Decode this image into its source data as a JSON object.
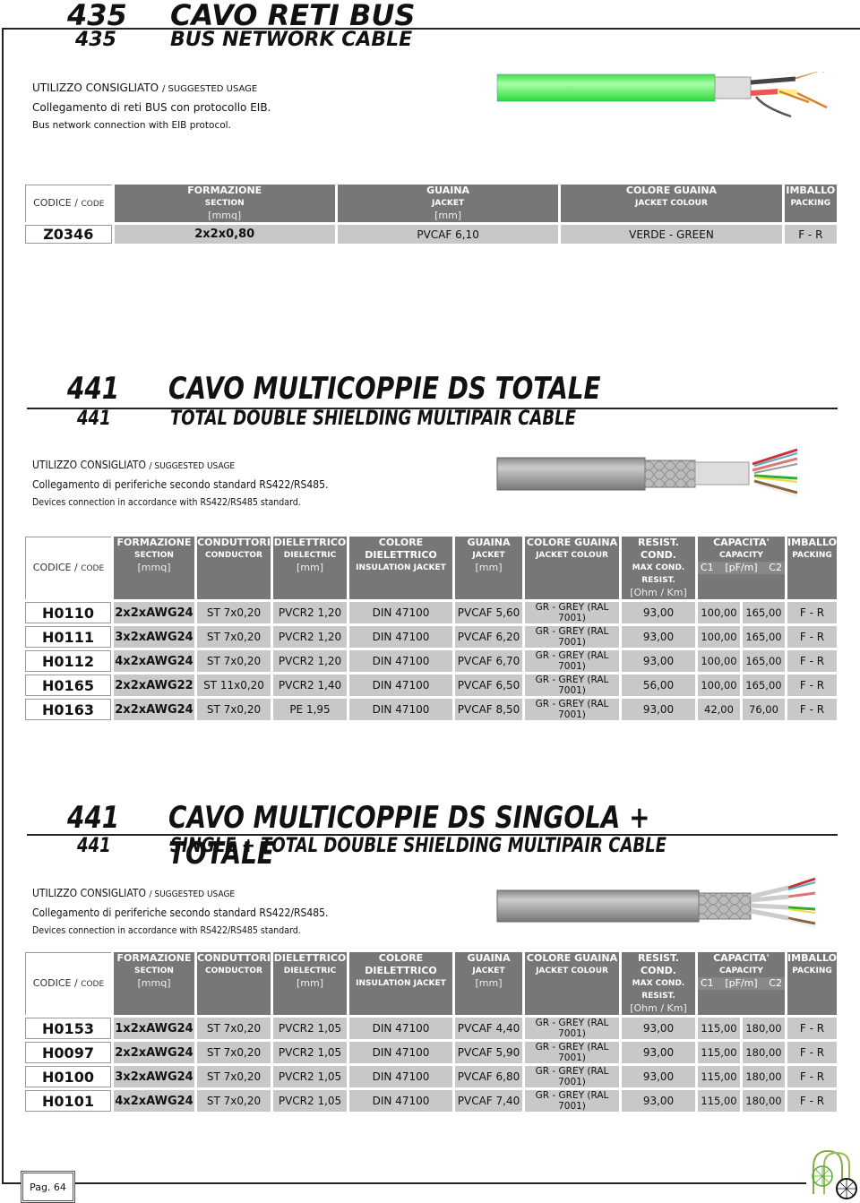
{
  "section_435": {
    "number": "435",
    "title_it": "CAVO RETI BUS",
    "title_en": "BUS NETWORK CABLE",
    "usage_label_it": "UTILIZZO CONSIGLIATO",
    "usage_label_en": "/ SUGGESTED USAGE",
    "usage_it": "Collegamento di reti BUS con protocollo EIB.",
    "usage_en": "Bus network connection with EIB protocol.",
    "table": {
      "code_header": "CODICE /",
      "code_header_small": "CODE",
      "headers": [
        {
          "it": "FORMAZIONE",
          "en": "SECTION",
          "unit": "[mmq]"
        },
        {
          "it": "GUAINA",
          "en": "JACKET",
          "unit": "[mm]"
        },
        {
          "it": "COLORE GUAINA",
          "en": "JACKET COLOUR",
          "unit": ""
        },
        {
          "it": "IMBALLO",
          "en": "PACKING",
          "unit": ""
        }
      ],
      "rows": [
        {
          "code": "Z0346",
          "section": "2x2x0,80",
          "jacket": "PVCAF 6,10",
          "colour": "VERDE - GREEN",
          "packing": "F - R"
        }
      ]
    }
  },
  "section_441a": {
    "number": "441",
    "title_it": "CAVO MULTICOPPIE DS TOTALE",
    "title_en": "TOTAL DOUBLE SHIELDING MULTIPAIR CABLE",
    "usage_label_it": "UTILIZZO CONSIGLIATO",
    "usage_label_en": "/ SUGGESTED USAGE",
    "usage_it": "Collegamento di periferiche secondo standard RS422/RS485.",
    "usage_en": "Devices connection in accordance with RS422/RS485 standard.",
    "table": {
      "code_header": "CODICE /",
      "code_header_small": "CODE",
      "headers": [
        {
          "it": "FORMAZIONE",
          "en": "SECTION",
          "unit": "[mmq]"
        },
        {
          "it": "CONDUTTORI",
          "en": "CONDUCTOR",
          "unit": ""
        },
        {
          "it": "DIELETTRICO",
          "en": "DIELECTRIC",
          "unit": "[mm]"
        },
        {
          "it": "COLORE DIELETTRICO",
          "en": "INSULATION JACKET",
          "unit": ""
        },
        {
          "it": "GUAINA",
          "en": "JACKET",
          "unit": "[mm]"
        },
        {
          "it": "COLORE GUAINA",
          "en": "JACKET COLOUR",
          "unit": ""
        },
        {
          "it": "RESIST. COND.",
          "en": "MAX COND. RESIST.",
          "unit": "[Ohm / Km]"
        },
        {
          "it": "CAPACITA'",
          "en": "CAPACITY",
          "unit": "[pF/m]",
          "c1": "C1",
          "c2": "C2"
        },
        {
          "it": "IMBALLO",
          "en": "PACKING",
          "unit": ""
        }
      ],
      "rows": [
        {
          "code": "H0110",
          "section": "2x2xAWG24",
          "conductor": "ST 7x0,20",
          "dielectric": "PVCR2 1,20",
          "insulation": "DIN 47100",
          "jacket": "PVCAF 5,60",
          "colour": "GR - GREY (RAL 7001)",
          "resist": "93,00",
          "c1": "100,00",
          "c2": "165,00",
          "packing": "F - R"
        },
        {
          "code": "H0111",
          "section": "3x2xAWG24",
          "conductor": "ST 7x0,20",
          "dielectric": "PVCR2 1,20",
          "insulation": "DIN 47100",
          "jacket": "PVCAF 6,20",
          "colour": "GR - GREY (RAL 7001)",
          "resist": "93,00",
          "c1": "100,00",
          "c2": "165,00",
          "packing": "F - R"
        },
        {
          "code": "H0112",
          "section": "4x2xAWG24",
          "conductor": "ST 7x0,20",
          "dielectric": "PVCR2 1,20",
          "insulation": "DIN 47100",
          "jacket": "PVCAF 6,70",
          "colour": "GR - GREY (RAL 7001)",
          "resist": "93,00",
          "c1": "100,00",
          "c2": "165,00",
          "packing": "F - R"
        },
        {
          "code": "H0165",
          "section": "2x2xAWG22",
          "conductor": "ST 11x0,20",
          "dielectric": "PVCR2 1,40",
          "insulation": "DIN 47100",
          "jacket": "PVCAF 6,50",
          "colour": "GR - GREY (RAL 7001)",
          "resist": "56,00",
          "c1": "100,00",
          "c2": "165,00",
          "packing": "F - R"
        },
        {
          "code": "H0163",
          "section": "2x2xAWG24",
          "conductor": "ST 7x0,20",
          "dielectric": "PE 1,95",
          "insulation": "DIN 47100",
          "jacket": "PVCAF 8,50",
          "colour": "GR - GREY (RAL 7001)",
          "resist": "93,00",
          "c1": "42,00",
          "c2": "76,00",
          "packing": "F - R"
        }
      ]
    }
  },
  "section_441b": {
    "number": "441",
    "title_it": "CAVO MULTICOPPIE DS SINGOLA + TOTALE",
    "title_en": "SINGLE + TOTAL DOUBLE SHIELDING MULTIPAIR CABLE",
    "usage_label_it": "UTILIZZO CONSIGLIATO",
    "usage_label_en": "/ SUGGESTED USAGE",
    "usage_it": "Collegamento di periferiche secondo standard RS422/RS485.",
    "usage_en": "Devices connection in accordance with RS422/RS485 standard.",
    "table": {
      "code_header": "CODICE /",
      "code_header_small": "CODE",
      "headers": [
        {
          "it": "FORMAZIONE",
          "en": "SECTION",
          "unit": "[mmq]"
        },
        {
          "it": "CONDUTTORI",
          "en": "CONDUCTOR",
          "unit": ""
        },
        {
          "it": "DIELETTRICO",
          "en": "DIELECTRIC",
          "unit": "[mm]"
        },
        {
          "it": "COLORE DIELETTRICO",
          "en": "INSULATION JACKET",
          "unit": ""
        },
        {
          "it": "GUAINA",
          "en": "JACKET",
          "unit": "[mm]"
        },
        {
          "it": "COLORE GUAINA",
          "en": "JACKET COLOUR",
          "unit": ""
        },
        {
          "it": "RESIST. COND.",
          "en": "MAX COND. RESIST.",
          "unit": "[Ohm / Km]"
        },
        {
          "it": "CAPACITA'",
          "en": "CAPACITY",
          "unit": "[pF/m]",
          "c1": "C1",
          "c2": "C2"
        },
        {
          "it": "IMBALLO",
          "en": "PACKING",
          "unit": ""
        }
      ],
      "rows": [
        {
          "code": "H0153",
          "section": "1x2xAWG24",
          "conductor": "ST 7x0,20",
          "dielectric": "PVCR2 1,05",
          "insulation": "DIN 47100",
          "jacket": "PVCAF 4,40",
          "colour": "GR - GREY (RAL 7001)",
          "resist": "93,00",
          "c1": "115,00",
          "c2": "180,00",
          "packing": "F - R"
        },
        {
          "code": "H0097",
          "section": "2x2xAWG24",
          "conductor": "ST 7x0,20",
          "dielectric": "PVCR2 1,05",
          "insulation": "DIN 47100",
          "jacket": "PVCAF 5,90",
          "colour": "GR - GREY (RAL 7001)",
          "resist": "93,00",
          "c1": "115,00",
          "c2": "180,00",
          "packing": "F - R"
        },
        {
          "code": "H0100",
          "section": "3x2xAWG24",
          "conductor": "ST 7x0,20",
          "dielectric": "PVCR2 1,05",
          "insulation": "DIN 47100",
          "jacket": "PVCAF 6,80",
          "colour": "GR - GREY (RAL 7001)",
          "resist": "93,00",
          "c1": "115,00",
          "c2": "180,00",
          "packing": "F - R"
        },
        {
          "code": "H0101",
          "section": "4x2xAWG24",
          "conductor": "ST 7x0,20",
          "dielectric": "PVCR2 1,05",
          "insulation": "DIN 47100",
          "jacket": "PVCAF 7,40",
          "colour": "GR - GREY (RAL 7001)",
          "resist": "93,00",
          "c1": "115,00",
          "c2": "180,00",
          "packing": "F - R"
        }
      ]
    }
  },
  "images": {
    "cable_435": "green-bus-cable-icon",
    "cable_441a": "grey-shielded-multipair-cable-icon",
    "cable_441b": "grey-single-total-shielded-cable-icon",
    "cable_435_colour": "#44ee55",
    "cable_grey_colour": "#9a9a9a"
  },
  "footer": {
    "page_label": "Pag. 64",
    "logo": "company-logo-icon"
  }
}
